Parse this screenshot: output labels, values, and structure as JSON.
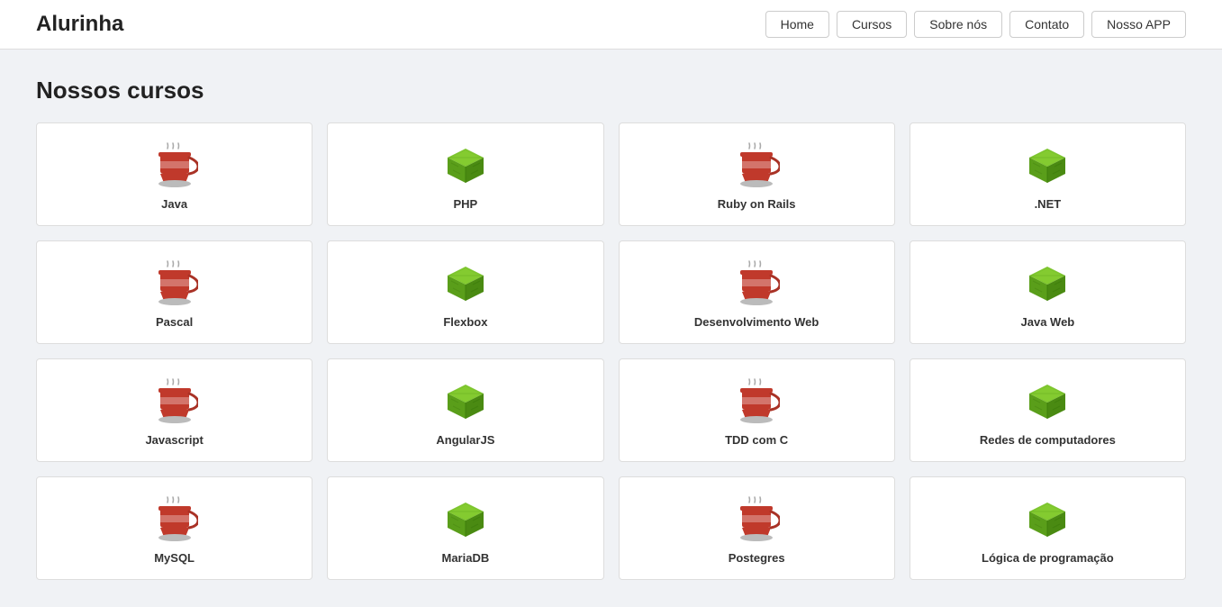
{
  "header": {
    "title": "Alurinha",
    "nav": [
      {
        "label": "Home",
        "id": "nav-home"
      },
      {
        "label": "Cursos",
        "id": "nav-cursos"
      },
      {
        "label": "Sobre nós",
        "id": "nav-sobre"
      },
      {
        "label": "Contato",
        "id": "nav-contato"
      },
      {
        "label": "Nosso APP",
        "id": "nav-app"
      }
    ]
  },
  "main": {
    "section_title": "Nossos cursos",
    "courses": [
      {
        "label": "Java",
        "icon": "coffee",
        "id": "java"
      },
      {
        "label": "PHP",
        "icon": "cube",
        "id": "php"
      },
      {
        "label": "Ruby on Rails",
        "icon": "coffee",
        "id": "ruby"
      },
      {
        "label": ".NET",
        "icon": "cube",
        "id": "dotnet"
      },
      {
        "label": "Pascal",
        "icon": "coffee",
        "id": "pascal"
      },
      {
        "label": "Flexbox",
        "icon": "cube",
        "id": "flexbox"
      },
      {
        "label": "Desenvolvimento Web",
        "icon": "coffee",
        "id": "devweb"
      },
      {
        "label": "Java Web",
        "icon": "cube",
        "id": "javaweb"
      },
      {
        "label": "Javascript",
        "icon": "coffee",
        "id": "javascript"
      },
      {
        "label": "AngularJS",
        "icon": "cube",
        "id": "angularjs"
      },
      {
        "label": "TDD com C",
        "icon": "coffee",
        "id": "tdd"
      },
      {
        "label": "Redes de computadores",
        "icon": "cube",
        "id": "redes"
      },
      {
        "label": "MySQL",
        "icon": "coffee",
        "id": "mysql"
      },
      {
        "label": "MariaDB",
        "icon": "cube",
        "id": "mariadb"
      },
      {
        "label": "Postegres",
        "icon": "coffee",
        "id": "postgres"
      },
      {
        "label": "Lógica de programação",
        "icon": "cube",
        "id": "logica"
      }
    ]
  }
}
